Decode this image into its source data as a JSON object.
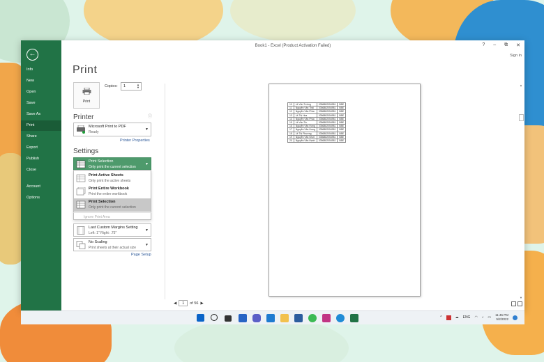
{
  "window": {
    "title": "Book1 - Excel (Product Activation Failed)",
    "sign_in": "Sign in",
    "controls": [
      "?",
      "–",
      "⧉",
      "✕"
    ]
  },
  "nav": {
    "items": [
      "Info",
      "New",
      "Open",
      "Save",
      "Save As",
      "Print",
      "Share",
      "Export",
      "Publish",
      "Close",
      "Account",
      "Options"
    ],
    "active": "Print"
  },
  "print": {
    "title": "Print",
    "button_label": "Print",
    "copies_label": "Copies:",
    "copies_value": "1"
  },
  "printer": {
    "section_title": "Printer",
    "name": "Microsoft Print to PDF",
    "status": "Ready",
    "properties_link": "Printer Properties"
  },
  "settings": {
    "section_title": "Settings",
    "current": {
      "title": "Print Selection",
      "desc": "Only print the current selection"
    },
    "options": [
      {
        "title": "Print Active Sheets",
        "desc": "Only print the active sheets"
      },
      {
        "title": "Print Entire Workbook",
        "desc": "Print the entire workbook"
      },
      {
        "title": "Print Selection",
        "desc": "Only print the current selection"
      }
    ],
    "ignore_print_area": "Ignore Print Area",
    "margins": {
      "title": "Last Custom Margins Setting",
      "desc": "Left: 1\"   Right: .75\""
    },
    "scaling": {
      "title": "No Scaling",
      "desc": "Print sheets at their actual size"
    },
    "page_setup_link": "Page Setup"
  },
  "preview": {
    "page_current": "1",
    "page_total": "of 56",
    "rows": [
      [
        "10",
        "Lê Văn Tường",
        "0356882054981",
        "BBE"
      ],
      [
        "11",
        "Nguyễn Văn Thái",
        "0356882054981",
        "BBE"
      ],
      [
        "12",
        "Nguyễn Văn Phúc",
        "0356882054981",
        "BBE"
      ],
      [
        "13",
        "Lê Thị Hoa",
        "0356882054981",
        "BBE"
      ],
      [
        "14",
        "Nguyễn Văn Phúc",
        "0356882054981",
        "BBE"
      ],
      [
        "15",
        "Lê Văn Tín",
        "0356882054981",
        "BBE"
      ],
      [
        "16",
        "Nguyễn Văn Hưng",
        "0356882054981",
        "BBE"
      ],
      [
        "17",
        "Nguyễn Văn Hưng",
        "0356882054981",
        "BBE"
      ],
      [
        "18",
        "Lê Thị Phương",
        "0356882054981",
        "BBE"
      ],
      [
        "19",
        "Nguyễn Văn Nhựt",
        "0356882054981",
        "BBE"
      ],
      [
        "20",
        "Nguyễn Văn Hạnh",
        "0356882054981",
        "BBE"
      ]
    ]
  },
  "taskbar": {
    "lang": "ENG",
    "time": "11:45 PM",
    "date": "5/2/2022"
  },
  "colors": {
    "nav_green": "#217346",
    "nav_active": "#1a5c37",
    "selection_green": "#4e9a6c"
  }
}
